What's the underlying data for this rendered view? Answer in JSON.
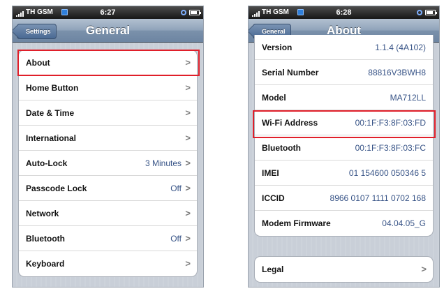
{
  "left_screen": {
    "status": {
      "carrier": "TH GSM",
      "time": "6:27"
    },
    "nav": {
      "back_label": "Settings",
      "title": "General"
    },
    "rows": [
      {
        "label": "About",
        "value": "",
        "chevron": ">"
      },
      {
        "label": "Home Button",
        "value": "",
        "chevron": ">"
      },
      {
        "label": "Date & Time",
        "value": "",
        "chevron": ">"
      },
      {
        "label": "International",
        "value": "",
        "chevron": ">"
      },
      {
        "label": "Auto-Lock",
        "value": "3 Minutes",
        "chevron": ">"
      },
      {
        "label": "Passcode Lock",
        "value": "Off",
        "chevron": ">"
      },
      {
        "label": "Network",
        "value": "",
        "chevron": ">"
      },
      {
        "label": "Bluetooth",
        "value": "Off",
        "chevron": ">"
      },
      {
        "label": "Keyboard",
        "value": "",
        "chevron": ">"
      }
    ]
  },
  "right_screen": {
    "status": {
      "carrier": "TH GSM",
      "time": "6:28"
    },
    "nav": {
      "back_label": "General",
      "title": "About"
    },
    "rows": [
      {
        "label": "Version",
        "value": "1.1.4 (4A102)"
      },
      {
        "label": "Serial Number",
        "value": "88816V3BWH8"
      },
      {
        "label": "Model",
        "value": "MA712LL"
      },
      {
        "label": "Wi-Fi Address",
        "value": "00:1F:F3:8F:03:FD"
      },
      {
        "label": "Bluetooth",
        "value": "00:1F:F3:8F:03:FC"
      },
      {
        "label": "IMEI",
        "value": "01 154600 050346 5"
      },
      {
        "label": "ICCID",
        "value": "8966 0107 1111 0702 168"
      },
      {
        "label": "Modem Firmware",
        "value": "04.04.05_G"
      }
    ],
    "legal": {
      "label": "Legal",
      "chevron": ">"
    }
  },
  "colors": {
    "highlight": "#e01f2a",
    "value_text": "#385487",
    "nav_bar": "#7b91ab"
  }
}
